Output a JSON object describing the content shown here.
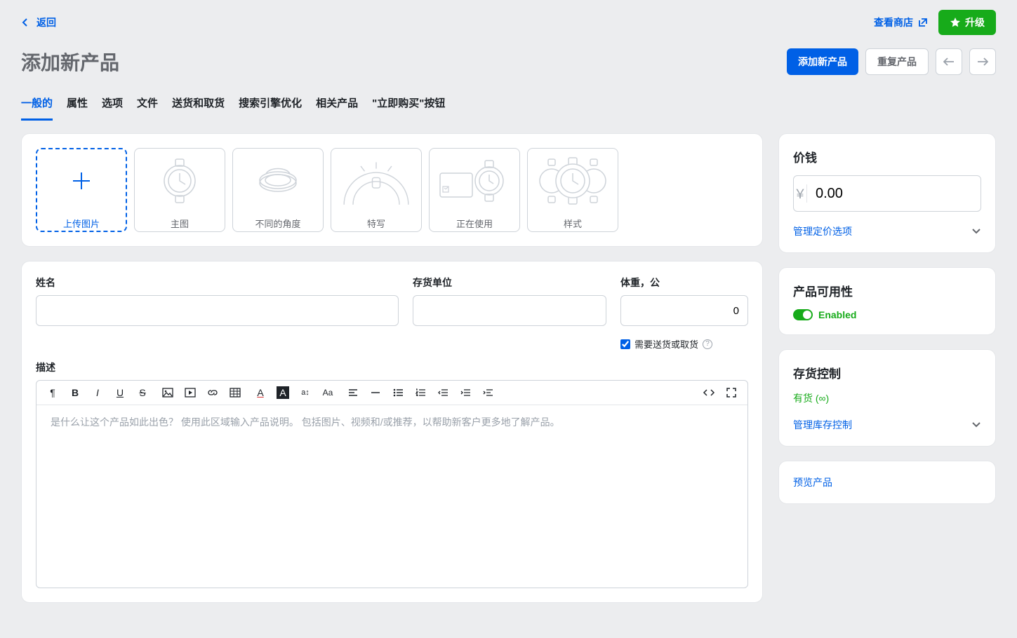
{
  "topbar": {
    "back_label": "返回",
    "view_store_label": "查看商店",
    "upgrade_label": "升级"
  },
  "header": {
    "title": "添加新产品",
    "add_product_btn": "添加新产品",
    "duplicate_btn": "重复产品"
  },
  "tabs": [
    "一般的",
    "属性",
    "选项",
    "文件",
    "送货和取货",
    "搜索引擎优化",
    "相关产品",
    "\"立即购买\"按钮"
  ],
  "active_tab": 0,
  "images": {
    "upload_label": "上传图片",
    "tiles": [
      "主图",
      "不同的角度",
      "特写",
      "正在使用",
      "样式"
    ]
  },
  "fields": {
    "name_label": "姓名",
    "name_value": "",
    "sku_label": "存货单位",
    "sku_value": "",
    "weight_label": "体重，公",
    "weight_value": "0",
    "requires_shipping_label": "需要送货或取货",
    "description_label": "描述",
    "description_placeholder": "是什么让这个产品如此出色？ 使用此区域输入产品说明。 包括图片、视频和/或推荐，以帮助新客户更多地了解产品。"
  },
  "price": {
    "title": "价钱",
    "currency": "￥",
    "value": "0.00",
    "manage_link": "管理定价选项"
  },
  "availability": {
    "title": "产品可用性",
    "enabled_label": "Enabled"
  },
  "stock": {
    "title": "存货控制",
    "status": "有货 (∞)",
    "manage_link": "管理库存控制"
  },
  "preview": {
    "link": "预览产品"
  }
}
